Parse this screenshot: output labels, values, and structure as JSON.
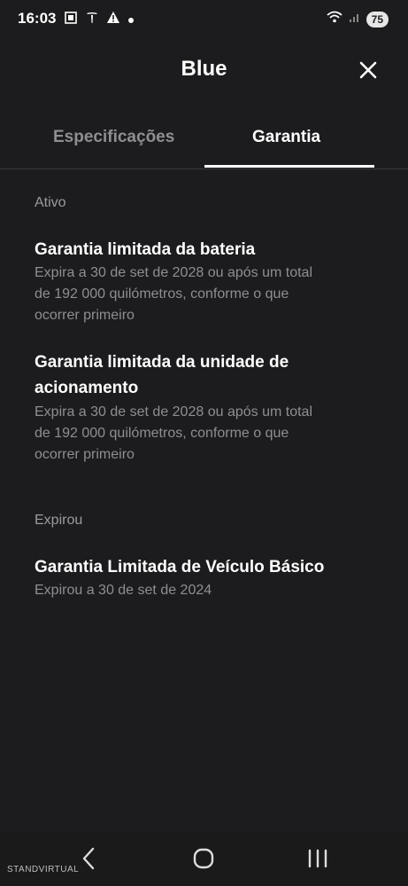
{
  "status_bar": {
    "time": "16:03",
    "battery": "75"
  },
  "header": {
    "title": "Blue",
    "close_icon": "close-icon"
  },
  "tabs": [
    {
      "label": "Especificações",
      "active": false
    },
    {
      "label": "Garantia",
      "active": true
    }
  ],
  "sections": {
    "active": {
      "label": "Ativo",
      "items": [
        {
          "title": "Garantia limitada da bateria",
          "desc": [
            "Expira a 30 de set de 2028 ou após um total",
            "de 192 000 quilómetros, conforme o que",
            "ocorrer primeiro"
          ]
        },
        {
          "title": [
            "Garantia limitada da unidade de",
            "acionamento"
          ],
          "desc": [
            "Expira a 30 de set de 2028 ou após um total",
            "de 192 000 quilómetros, conforme o que",
            "ocorrer primeiro"
          ]
        }
      ]
    },
    "expired": {
      "label": "Expirou",
      "items": [
        {
          "title": "Garantia Limitada de Veículo Básico",
          "desc": [
            "Expirou a 30 de set de 2024"
          ]
        }
      ]
    }
  },
  "watermark": "STANDVIRTUAL",
  "colors": {
    "background": "#1c1c1e",
    "text_primary": "#ffffff",
    "text_secondary": "#8e8e93",
    "divider": "#3a3a3c"
  }
}
